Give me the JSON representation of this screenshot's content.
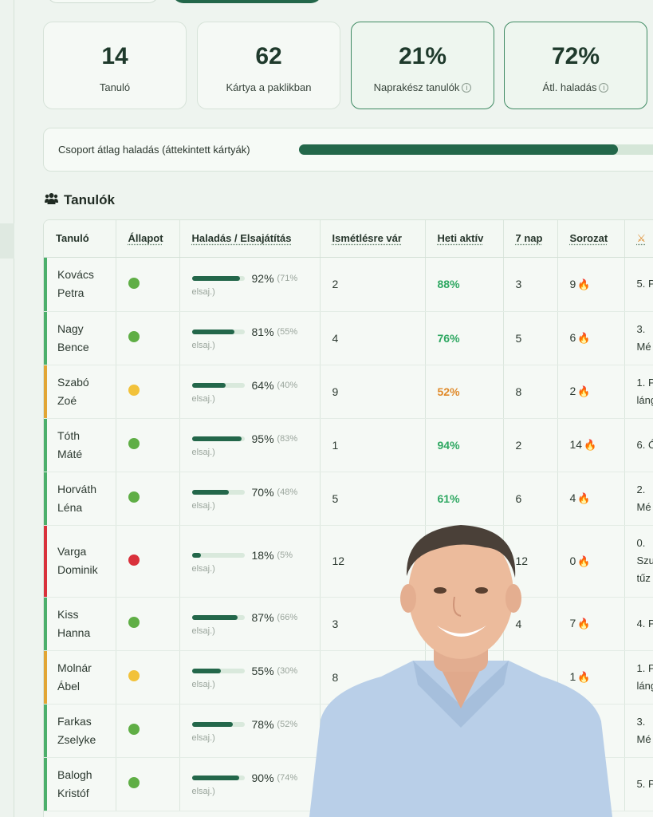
{
  "stats": [
    {
      "value": "14",
      "label": "Tanuló",
      "info": false
    },
    {
      "value": "62",
      "label": "Kártya a paklikban",
      "info": false
    },
    {
      "value": "21%",
      "label": "Naprakész tanulók",
      "info": true
    },
    {
      "value": "72%",
      "label": "Átl. haladás",
      "info": true
    }
  ],
  "group_progress": {
    "label": "Csoport átlag haladás (áttekintett kártyák)",
    "value": 0.87
  },
  "students_title": "Tanulók",
  "table": {
    "headers": [
      "Tanuló",
      "Állapot",
      "Haladás / Elsajátítás",
      "Ismétlésre vár",
      "Heti aktív",
      "7 nap",
      "Sorozat",
      "⚔"
    ],
    "rows": [
      {
        "first": "Kovács",
        "last": "Petra",
        "status": "#5fae45",
        "stripe": "#4caf6b",
        "progress": "92%",
        "progress_value": 0.92,
        "mastery": "(71%",
        "mastery_end": "elsaj.)",
        "due": "2",
        "weekly": "88%",
        "weekly_color": "#2fa862",
        "seven_days": "3",
        "streak": "9",
        "ach1": "5. P",
        "ach2": ""
      },
      {
        "first": "Nagy",
        "last": "Bence",
        "status": "#5fae45",
        "stripe": "#4caf6b",
        "progress": "81%",
        "progress_value": 0.81,
        "mastery": "(55%",
        "mastery_end": "elsaj.)",
        "due": "4",
        "weekly": "76%",
        "weekly_color": "#2fa862",
        "seven_days": "5",
        "streak": "6",
        "ach1": "3.",
        "ach2": "Mé"
      },
      {
        "first": "Szabó",
        "last": "Zoé",
        "status": "#f2c23a",
        "stripe": "#e2a534",
        "progress": "64%",
        "progress_value": 0.64,
        "mastery": "(40%",
        "mastery_end": "elsaj.)",
        "due": "9",
        "weekly": "52%",
        "weekly_color": "#e08a2a",
        "seven_days": "8",
        "streak": "2",
        "ach1": "1. P",
        "ach2": "láng"
      },
      {
        "first": "Tóth",
        "last": "Máté",
        "status": "#5fae45",
        "stripe": "#4caf6b",
        "progress": "95%",
        "progress_value": 0.95,
        "mastery": "(83%",
        "mastery_end": "elsaj.)",
        "due": "1",
        "weekly": "94%",
        "weekly_color": "#2fa862",
        "seven_days": "2",
        "streak": "14",
        "ach1": "6. Ó",
        "ach2": ""
      },
      {
        "first": "Horváth",
        "last": "Léna",
        "status": "#5fae45",
        "stripe": "#4caf6b",
        "progress": "70%",
        "progress_value": 0.7,
        "mastery": "(48%",
        "mastery_end": "elsaj.)",
        "due": "5",
        "weekly": "61%",
        "weekly_color": "#2fa862",
        "seven_days": "6",
        "streak": "4",
        "ach1": "2.",
        "ach2": "Mé"
      },
      {
        "first": "Varga",
        "last": "Dominik",
        "status": "#d9313b",
        "stripe": "#d9313b",
        "progress": "18%",
        "progress_value": 0.18,
        "mastery": "(5%",
        "mastery_end": "elsaj.)",
        "due": "12",
        "weekly": "",
        "weekly_color": "#2fa862",
        "seven_days": "12",
        "streak": "0",
        "ach1": "0.",
        "ach2": "Szu",
        "ach3": "tűz"
      },
      {
        "first": "Kiss",
        "last": "Hanna",
        "status": "#5fae45",
        "stripe": "#4caf6b",
        "progress": "87%",
        "progress_value": 0.87,
        "mastery": "(66%",
        "mastery_end": "elsaj.)",
        "due": "3",
        "weekly": "",
        "weekly_color": "#2fa862",
        "seven_days": "4",
        "streak": "7",
        "ach1": "4. P",
        "ach2": ""
      },
      {
        "first": "Molnár",
        "last": "Ábel",
        "status": "#f2c23a",
        "stripe": "#e2a534",
        "progress": "55%",
        "progress_value": 0.55,
        "mastery": "(30%",
        "mastery_end": "elsaj.)",
        "due": "8",
        "weekly": "",
        "weekly_color": "#2fa862",
        "seven_days": "",
        "streak": "1",
        "ach1": "1. P",
        "ach2": "láng"
      },
      {
        "first": "Farkas",
        "last": "Zselyke",
        "status": "#5fae45",
        "stripe": "#4caf6b",
        "progress": "78%",
        "progress_value": 0.78,
        "mastery": "(52%",
        "mastery_end": "elsaj.)",
        "due": "",
        "weekly": "",
        "weekly_color": "#2fa862",
        "seven_days": "",
        "streak": "",
        "ach1": "3.",
        "ach2": "Mé"
      },
      {
        "first": "Balogh",
        "last": "Kristóf",
        "status": "#5fae45",
        "stripe": "#4caf6b",
        "progress": "90%",
        "progress_value": 0.9,
        "mastery": "(74%",
        "mastery_end": "elsaj.)",
        "due": "",
        "weekly": "",
        "weekly_color": "#2fa862",
        "seven_days": "",
        "streak": "",
        "ach1": "5. P",
        "ach2": ""
      }
    ]
  },
  "colors": {
    "accent": "#23674a",
    "good": "#2fa862",
    "warn": "#e08a2a",
    "bad": "#d9313b"
  }
}
